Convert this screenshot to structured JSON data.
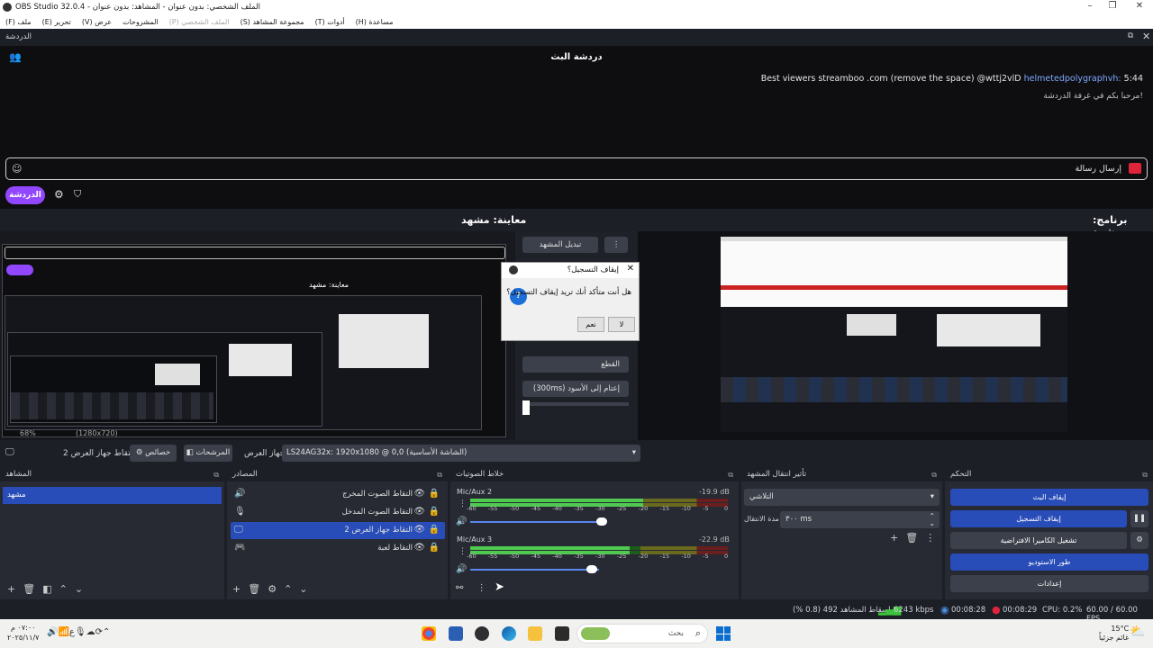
{
  "window": {
    "title": "OBS Studio 32.0.4 - الملف الشخصي: بدون عنوان - المشاهد: بدون عنوان"
  },
  "menu": {
    "items": [
      "(F) ملف",
      "(E) تحرير",
      "(V) عرض",
      "المشروحات",
      "(P) الملف الشخصي",
      "(S) مجموعة المشاهد",
      "(T) أدوات",
      "(H) مساعدة"
    ]
  },
  "chat_dock": {
    "title": "الدردشة",
    "heading": "دردشة البث",
    "messages": [
      {
        "time": "5:44",
        "user": "helmetedpolygraphvh:",
        "text": "Best viewers streamboo .com (remove the space) @wttj2vlD"
      },
      {
        "text": "مرحبا بكم في غرفة الدردشة!"
      }
    ],
    "send_placeholder": "إرسال رسالة",
    "chat_button": "الدردشة"
  },
  "preview": {
    "label": "معاينة: مشهد",
    "nested_label": "معاينة: مشهد",
    "zoom": "68%",
    "resolution": "(1280x720)"
  },
  "program": {
    "label": "برنامج: مشهد"
  },
  "transition_panel": {
    "swap_button": "تبديل المشهد",
    "fade_option": "التلاشي",
    "cut_option": "القطع",
    "fade_black": "إعتام إلى الأسود (300ms)"
  },
  "dialog": {
    "title": "إيقاف التسجيل؟",
    "message": "هل أنت متأكد أنك تريد إيقاف التسجيل؟",
    "yes": "نعم",
    "no": "لا"
  },
  "context_bar": {
    "source_name": "التقاط جهاز العرض 2",
    "properties": "خصائص",
    "filters": "المرشحات",
    "display_label": "جهاز العرض",
    "display_value": "LS24AG32x: 1920x1080 @ 0,0 (الشاشة الأساسية)"
  },
  "scenes": {
    "title": "المشاهد",
    "items": [
      "مشهد"
    ]
  },
  "sources": {
    "title": "المصادر",
    "items": [
      {
        "name": "التقاط الصوت المخرج",
        "icon": "speaker-icon"
      },
      {
        "name": "التقاط الصوت المدخل",
        "icon": "mic-icon"
      },
      {
        "name": "التقاط جهاز العرض 2",
        "icon": "monitor-icon",
        "selected": true
      },
      {
        "name": "التقاط لعبة",
        "icon": "gamepad-icon"
      }
    ]
  },
  "mixer": {
    "title": "خلاط الصوتيات",
    "ticks": [
      "-60",
      "-55",
      "-50",
      "-45",
      "-40",
      "-35",
      "-30",
      "-25",
      "-20",
      "-15",
      "-10",
      "-5",
      "0"
    ],
    "channels": [
      {
        "name": "Mic/Aux 2",
        "db": "-19.9 dB",
        "level": 0.67,
        "volume": 0.98
      },
      {
        "name": "Mic/Aux 3",
        "db": "-22.9 dB",
        "level": 0.62,
        "volume": 0.9
      }
    ]
  },
  "transitions": {
    "title": "تأثير انتقال المشهد",
    "type": "التلاشي",
    "duration_label": "مدة الانتقال",
    "duration_value": "٣٠٠ ms"
  },
  "controls": {
    "title": "التحكم",
    "stop_stream": "إيقاف البث",
    "stop_record": "إيقاف التسجيل",
    "virtual_cam": "تشغيل الكاميرا الافتراضية",
    "studio_mode": "طور الاستوديو",
    "settings": "إعدادات",
    "accent": "#284cb8"
  },
  "status": {
    "dropped": "إسقاط المشاهد 492 (0.8 %)",
    "bitrate": "6243 kbps",
    "stream_time": "00:08:28",
    "rec_time": "00:08:29",
    "cpu": "CPU: 0.2%",
    "fps": "60.00 / 60.00 FPS"
  },
  "taskbar": {
    "search": "بحث",
    "weather_temp": "15°C",
    "weather_text": "غائم جزئياً",
    "clock_time": "٠٧:٠٠ م",
    "clock_date": "٢٠٢٥/١١/٧"
  }
}
